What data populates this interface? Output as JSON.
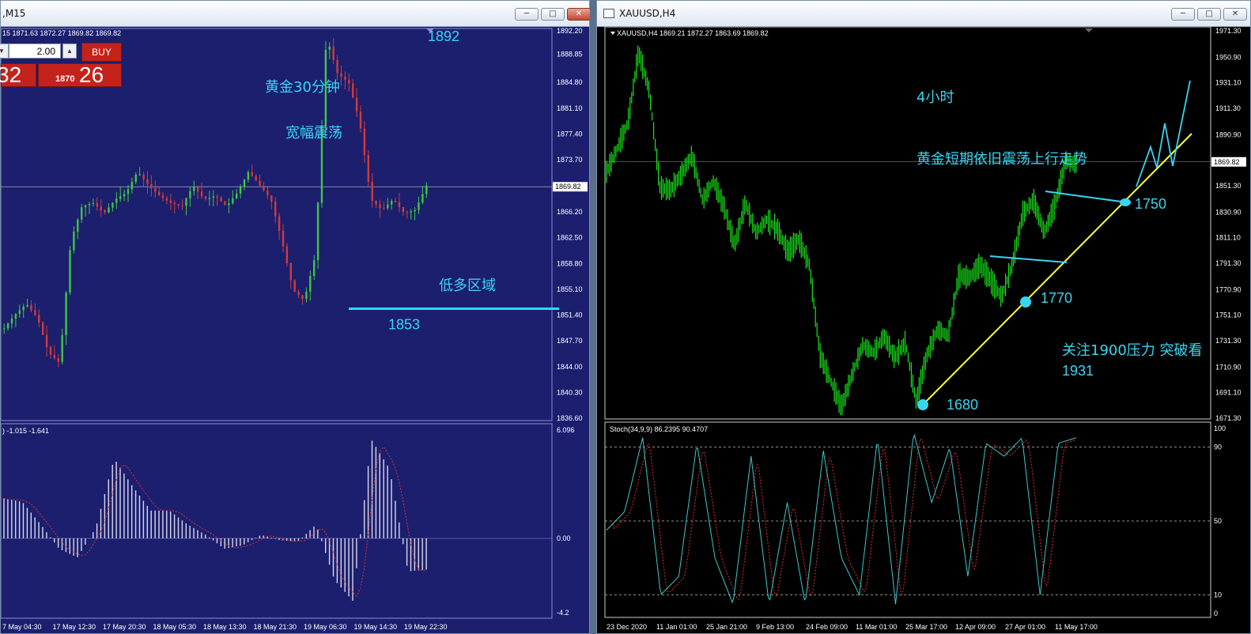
{
  "left_window": {
    "title": ",M15",
    "info_line": "15  1871.63 1872.27 1869.82 1869.82",
    "trade": {
      "lot": "2.00",
      "buy_label": "BUY",
      "sell_big": "32",
      "buy_small": "1870",
      "buy_big": "26"
    },
    "price_labels": [
      "1892.20",
      "1888.85",
      "1884.80",
      "1881.10",
      "1877.40",
      "1873.70",
      "1869.82",
      "1866.20",
      "1862.50",
      "1858.80",
      "1855.10",
      "1851.40",
      "1847.70",
      "1844.00",
      "1840.30",
      "1836.60"
    ],
    "current_price": "1869.82",
    "annotations": {
      "title1": "黄金30分钟",
      "title2": "宽幅震荡",
      "zone": "低多区域",
      "level_high": "1892",
      "level_low": "1853"
    },
    "indicator_info": ") -1.015 -1.641",
    "indicator_labels": [
      "6.096",
      "0.00",
      "-4.2"
    ],
    "time_labels": [
      "7 May 04:30",
      "17 May 12:30",
      "17 May 20:30",
      "18 May 05:30",
      "18 May 13:30",
      "18 May 21:30",
      "19 May 06:30",
      "19 May 14:30",
      "19 May 22:30"
    ],
    "colors": {
      "background": "#1c1f6e",
      "bull": "#3fc83f",
      "bear": "#d23a3a",
      "level": "#22e0ff",
      "annotation": "#38d6f2"
    }
  },
  "right_window": {
    "title": "XAUUSD,H4",
    "info_line": "XAUUSD,H4  1869.21 1872.27 1863.69 1869.82",
    "price_labels": [
      "1971.30",
      "1950.90",
      "1931.10",
      "1911.30",
      "1890.90",
      "1869.82",
      "1851.30",
      "1830.90",
      "1811.10",
      "1791.30",
      "1770.90",
      "1751.10",
      "1731.30",
      "1710.90",
      "1691.10",
      "1671.30"
    ],
    "current_price": "1869.82",
    "annotations": {
      "title": "4小时",
      "desc": "黄金短期依旧震荡上行走势",
      "p1680": "1680",
      "p1770": "1770",
      "p1750": "1750",
      "watch1": "关注1900压力 突破看",
      "watch2": "1931"
    },
    "stoch_info": "Stoch(34,9,9) 86.2395 90.4707",
    "stoch_levels": [
      "100",
      "90",
      "50",
      "10",
      "0"
    ],
    "time_labels": [
      "23 Dec 2020",
      "11 Jan 01:00",
      "25 Jan 21:00",
      "9 Feb 13:00",
      "24 Feb 09:00",
      "11 Mar 01:00",
      "25 Mar 17:00",
      "12 Apr 09:00",
      "27 Apr 01:00",
      "11 May 17:00"
    ],
    "colors": {
      "background": "#000000",
      "price": "#17e617",
      "trend": "#ffff33",
      "annotation": "#38d6f2"
    }
  }
}
